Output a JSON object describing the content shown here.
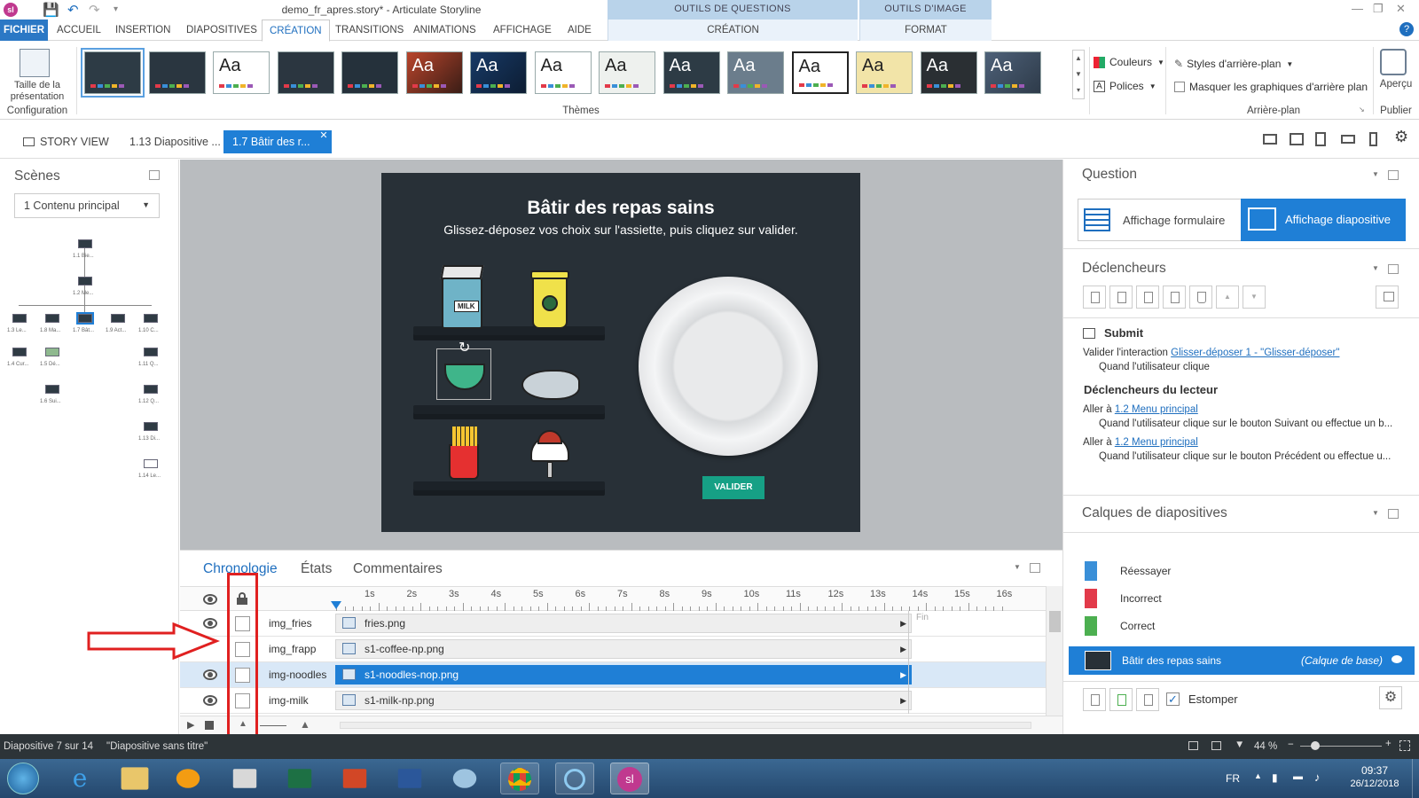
{
  "window": {
    "title": "demo_fr_apres.story* - Articulate Storyline",
    "app_logo": "sl"
  },
  "context_tabs": [
    {
      "header": "OUTILS DE QUESTIONS",
      "tab": "CRÉATION"
    },
    {
      "header": "OUTILS D'IMAGE",
      "tab": "FORMAT"
    }
  ],
  "menu_tabs": [
    "FICHIER",
    "ACCUEIL",
    "INSERTION",
    "DIAPOSITIVES",
    "CRÉATION",
    "TRANSITIONS",
    "ANIMATIONS",
    "AFFICHAGE",
    "AIDE"
  ],
  "ribbon": {
    "slide_size_label_1": "Taille de la",
    "slide_size_label_2": "présentation",
    "config_label": "Configuration",
    "themes_label": "Thèmes",
    "theme_text": "Aa",
    "colors_label": "Couleurs",
    "fonts_label": "Polices",
    "bg_styles_label": "Styles d'arrière-plan",
    "hide_bg_label": "Masquer les graphiques d'arrière plan",
    "background_label": "Arrière-plan",
    "preview_label": "Aperçu",
    "publish_label": "Publier"
  },
  "doc_tabs": {
    "story_view": "STORY VIEW",
    "tab1": "1.13 Diapositive ...",
    "tab2": "1.7 Bâtir des r..."
  },
  "scenes": {
    "title": "Scènes",
    "dropdown": "1 Contenu principal",
    "nodes": [
      "1.1 Bie...",
      "1.2 Me...",
      "1.3 Le...",
      "1.8 Ma...",
      "1.7 Bât...",
      "1.9 Act...",
      "1.10 C...",
      "1.4 Cur...",
      "1.5 Dé...",
      "1.11 Q...",
      "1.6 Sui...",
      "1.12 Q...",
      "1.13 Di...",
      "1.14 Le..."
    ]
  },
  "slide": {
    "title": "Bâtir des repas sains",
    "subtitle": "Glissez-déposez vos choix sur l'assiette, puis cliquez sur valider.",
    "milk_label": "MILK",
    "validate_button": "VALIDER"
  },
  "timeline": {
    "tabs": [
      "Chronologie",
      "États",
      "Commentaires"
    ],
    "ticks": [
      "1s",
      "2s",
      "3s",
      "4s",
      "5s",
      "6s",
      "7s",
      "8s",
      "9s",
      "10s",
      "11s",
      "12s",
      "13s",
      "14s",
      "15s",
      "16s"
    ],
    "end_label": "Fin",
    "rows": [
      {
        "name": "img_fries",
        "file": "fries.png",
        "visible": true
      },
      {
        "name": "img_frapp",
        "file": "s1-coffee-np.png",
        "visible": false
      },
      {
        "name": "img-noodles",
        "file": "s1-noodles-nop.png",
        "visible": true
      },
      {
        "name": "img-milk",
        "file": "s1-milk-np.png",
        "visible": true
      }
    ]
  },
  "right_panel": {
    "question_title": "Question",
    "form_view": "Affichage formulaire",
    "slide_view": "Affichage diapositive",
    "triggers_title": "Déclencheurs",
    "submit_label": "Submit",
    "trig1_prefix": "Valider l'interaction",
    "trig1_link": "Glisser-déposer 1 - \"Glisser-déposer\"",
    "trig1_when": "Quand l'utilisateur clique",
    "player_triggers": "Déclencheurs du lecteur",
    "goto_prefix": "Aller à",
    "goto_link": "1.2 Menu principal",
    "goto1_when": "Quand l'utilisateur clique sur le bouton Suivant ou effectue un b...",
    "goto2_when": "Quand l'utilisateur clique sur le bouton Précédent ou effectue u...",
    "layers_title": "Calques de diapositives",
    "layers": [
      {
        "name": "Réessayer",
        "color": "#3a8fd8"
      },
      {
        "name": "Incorrect",
        "color": "#e23a4a"
      },
      {
        "name": "Correct",
        "color": "#4caf50"
      }
    ],
    "base_layer": "Bâtir des repas sains",
    "base_layer_tag": "(Calque de base)",
    "fade_label": "Estomper"
  },
  "status": {
    "slide_count": "Diapositive 7 sur 14",
    "slide_name": "\"Diapositive sans titre\"",
    "zoom": "44 %"
  },
  "taskbar": {
    "lang": "FR",
    "time": "09:37",
    "date": "26/12/2018",
    "sl_badge": "sl"
  },
  "colors": {
    "accent": "#1f7fd6",
    "slide_bg": "#283037",
    "validate": "#16a085",
    "highlight": "#e02020"
  }
}
